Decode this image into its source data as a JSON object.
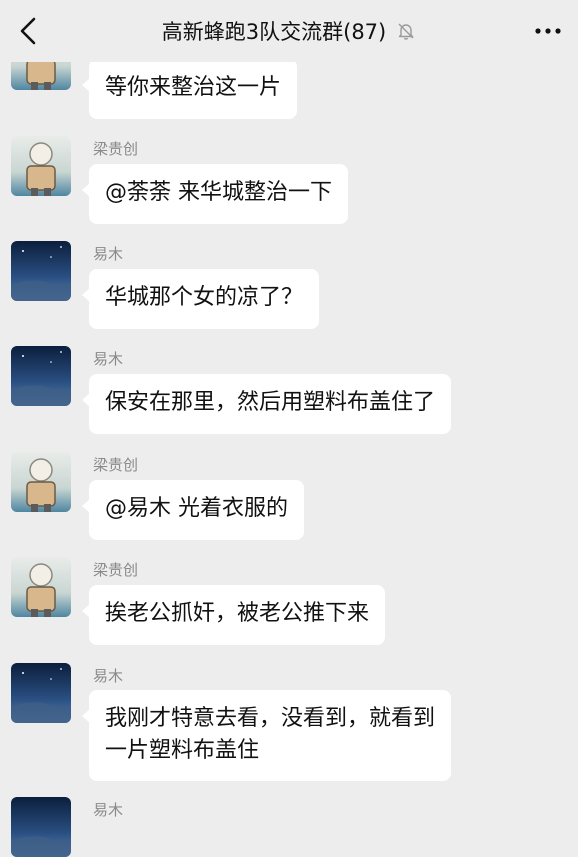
{
  "header": {
    "title": "高新蜂跑3队交流群(87)",
    "back_icon": "chevron-left-icon",
    "mute_icon": "bell-off-icon",
    "more_icon": "more-dots-icon"
  },
  "messages": [
    {
      "sender": "",
      "avatar": "cartoon-avatar",
      "text": [
        "等你来整治这一片"
      ]
    },
    {
      "sender": "梁贵创",
      "avatar": "cartoon-avatar",
      "text": [
        "@荼荼  来华城整治一下"
      ]
    },
    {
      "sender": "易木",
      "avatar": "night-sky-avatar",
      "text": [
        "华城那个女的凉了？"
      ]
    },
    {
      "sender": "易木",
      "avatar": "night-sky-avatar",
      "text": [
        "保安在那里，然后用塑料布盖住了"
      ]
    },
    {
      "sender": "梁贵创",
      "avatar": "cartoon-avatar",
      "text": [
        "@易木  光着衣服的"
      ]
    },
    {
      "sender": "梁贵创",
      "avatar": "cartoon-avatar",
      "text": [
        "挨老公抓奸，被老公推下来"
      ]
    },
    {
      "sender": "易木",
      "avatar": "night-sky-avatar",
      "text": [
        "我刚才特意去看，没看到，就看到",
        "一片塑料布盖住"
      ]
    },
    {
      "sender": "易木",
      "avatar": "night-sky-avatar",
      "text": []
    }
  ],
  "colors": {
    "background": "#ededed",
    "bubble": "#ffffff",
    "sender": "#8a8a8a",
    "text": "#111111"
  }
}
